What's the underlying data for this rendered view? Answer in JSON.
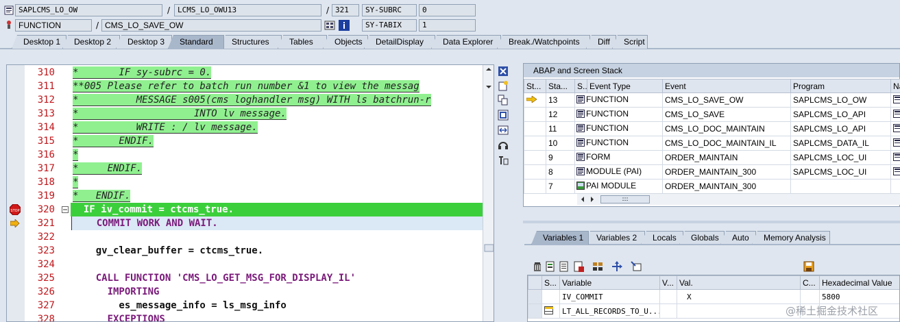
{
  "header": {
    "row1": {
      "program": "SAPLCMS_LO_OW",
      "include": "LCMS_LO_OWU13",
      "line": "321",
      "sy_label": "SY-SUBRC",
      "sy_value": "0"
    },
    "row2": {
      "event_type": "FUNCTION",
      "event": "CMS_LO_SAVE_OW",
      "sy_label": "SY-TABIX",
      "sy_value": "1"
    }
  },
  "tabs": [
    "Desktop 1",
    "Desktop 2",
    "Desktop 3",
    "Standard",
    "Structures",
    "Tables",
    "Objects",
    "DetailDisplay",
    "Data Explorer",
    "Break./Watchpoints",
    "Diff",
    "Script"
  ],
  "active_tab": "Standard",
  "editor": {
    "lines": [
      {
        "n": "310",
        "text": "*       IF sy-subrc = 0.",
        "type": "comment"
      },
      {
        "n": "311",
        "text": "**005 Please refer to batch run number &1 to view the messag",
        "type": "comment"
      },
      {
        "n": "312",
        "text": "*          MESSAGE s005(cms loghandler msg) WITH ls batchrun-r",
        "type": "comment"
      },
      {
        "n": "313",
        "text": "*                    INTO lv message.",
        "type": "comment"
      },
      {
        "n": "314",
        "text": "*          WRITE : / lv message.",
        "type": "comment"
      },
      {
        "n": "315",
        "text": "*       ENDIF.",
        "type": "comment"
      },
      {
        "n": "316",
        "text": "*",
        "type": "comment"
      },
      {
        "n": "317",
        "text": "*     ENDIF.",
        "type": "comment"
      },
      {
        "n": "318",
        "text": "*",
        "type": "comment"
      },
      {
        "n": "319",
        "text": "*   ENDIF.",
        "type": "comment"
      },
      {
        "n": "320",
        "text": "  IF iv_commit = ctcms_true.",
        "type": "breakpoint"
      },
      {
        "n": "321",
        "text": "    COMMIT WORK AND WAIT.",
        "type": "current"
      },
      {
        "n": "322",
        "text": "",
        "type": "code"
      },
      {
        "n": "323",
        "text": "    gv_clear_buffer = ctcms_true.",
        "type": "code"
      },
      {
        "n": "324",
        "text": "",
        "type": "code"
      },
      {
        "n": "325",
        "text": "    CALL FUNCTION 'CMS_LO_GET_MSG_FOR_DISPLAY_IL'",
        "type": "code"
      },
      {
        "n": "326",
        "text": "      IMPORTING",
        "type": "code"
      },
      {
        "n": "327",
        "text": "        es_message_info = ls_msg_info",
        "type": "code"
      },
      {
        "n": "328",
        "text": "      EXCEPTIONS",
        "type": "code"
      }
    ]
  },
  "stack": {
    "title": "ABAP and Screen Stack",
    "columns": [
      "St...",
      "Sta...",
      "S...",
      "Event Type",
      "Event",
      "Program",
      "Na"
    ],
    "rows": [
      {
        "level": "13",
        "event_type": "FUNCTION",
        "event": "CMS_LO_SAVE_OW",
        "program": "SAPLCMS_LO_OW",
        "current": true
      },
      {
        "level": "12",
        "event_type": "FUNCTION",
        "event": "CMS_LO_SAVE",
        "program": "SAPLCMS_LO_API"
      },
      {
        "level": "11",
        "event_type": "FUNCTION",
        "event": "CMS_LO_DOC_MAINTAIN",
        "program": "SAPLCMS_LO_API"
      },
      {
        "level": "10",
        "event_type": "FUNCTION",
        "event": "CMS_LO_DOC_MAINTAIN_IL",
        "program": "SAPLCMS_DATA_IL"
      },
      {
        "level": "9",
        "event_type": "FORM",
        "event": "ORDER_MAINTAIN",
        "program": "SAPLCMS_LOC_UI"
      },
      {
        "level": "8",
        "event_type": "MODULE (PAI)",
        "event": "ORDER_MAINTAIN_300",
        "program": "SAPLCMS_LOC_UI"
      },
      {
        "level": "7",
        "event_type": "PAI MODULE",
        "event": "ORDER_MAINTAIN_300",
        "program": ""
      }
    ],
    "scroll_label": ":::"
  },
  "var_tabs": [
    "Variables 1",
    "Variables 2",
    "Locals",
    "Globals",
    "Auto",
    "Memory Analysis"
  ],
  "active_var_tab": "Variables 1",
  "variables": {
    "columns": [
      "S...",
      "Variable",
      "V...",
      "Val.",
      "C...",
      "Hexadecimal Value"
    ],
    "rows": [
      {
        "variable": "IV_COMMIT",
        "value": "X",
        "hex": "5800"
      },
      {
        "variable": "LT_ALL_RECORDS_TO_U...",
        "value": "",
        "hex": ""
      }
    ]
  },
  "watermark": "@稀土掘金技术社区"
}
